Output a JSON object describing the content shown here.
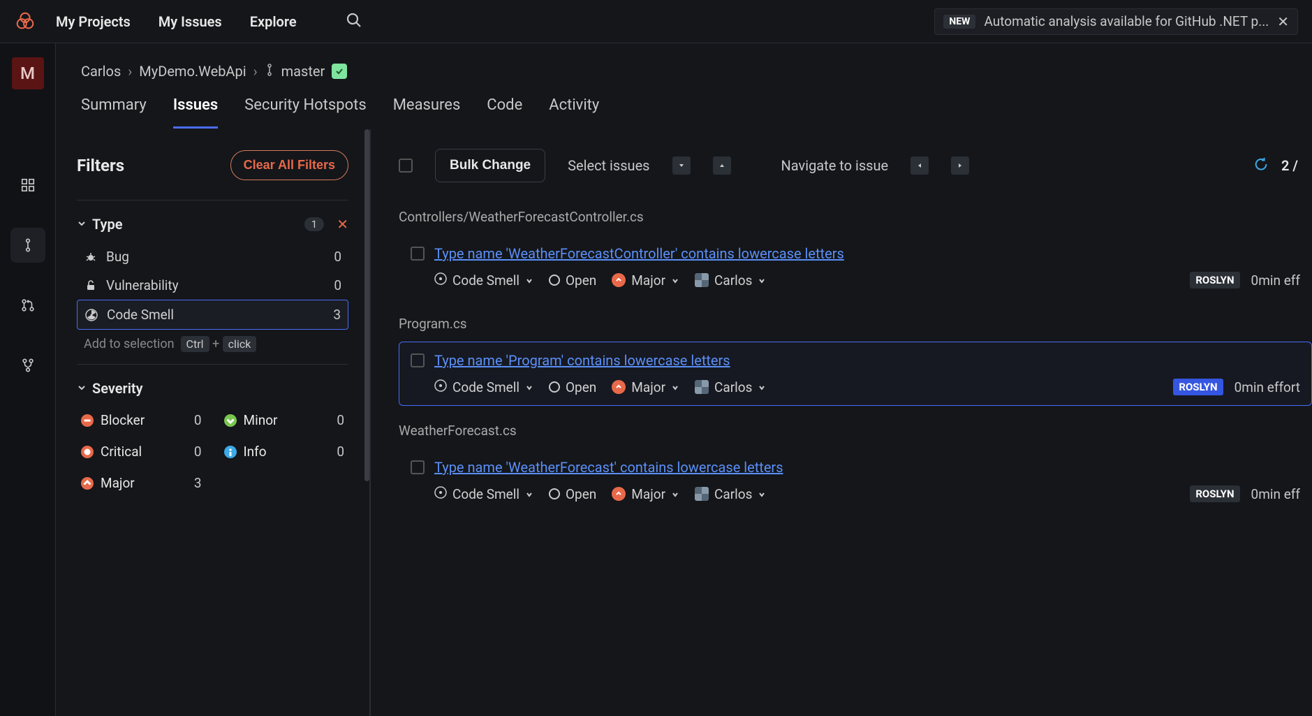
{
  "topnav": {
    "projects": "My Projects",
    "issues": "My Issues",
    "explore": "Explore"
  },
  "news": {
    "badge": "NEW",
    "text": "Automatic analysis available for GitHub .NET p..."
  },
  "avatar_letter": "M",
  "breadcrumb": {
    "owner": "Carlos",
    "project": "MyDemo.WebApi",
    "branch": "master"
  },
  "tabs": {
    "summary": "Summary",
    "issues": "Issues",
    "hotspots": "Security Hotspots",
    "measures": "Measures",
    "code": "Code",
    "activity": "Activity"
  },
  "filters": {
    "title": "Filters",
    "clear": "Clear All Filters",
    "type": {
      "label": "Type",
      "active_count": "1",
      "bug": {
        "label": "Bug",
        "count": "0"
      },
      "vuln": {
        "label": "Vulnerability",
        "count": "0"
      },
      "smell": {
        "label": "Code Smell",
        "count": "3"
      }
    },
    "hint": {
      "text": "Add to selection",
      "key1": "Ctrl",
      "plus": "+",
      "key2": "click"
    },
    "severity": {
      "label": "Severity",
      "blocker": {
        "label": "Blocker",
        "count": "0"
      },
      "critical": {
        "label": "Critical",
        "count": "0"
      },
      "major": {
        "label": "Major",
        "count": "3"
      },
      "minor": {
        "label": "Minor",
        "count": "0"
      },
      "info": {
        "label": "Info",
        "count": "0"
      }
    }
  },
  "toolbar": {
    "bulk": "Bulk Change",
    "select": "Select issues",
    "navigate": "Navigate to issue",
    "pager": "2 /"
  },
  "issues": {
    "file1": "Controllers/WeatherForecastController.cs",
    "issue1": {
      "title": "Type name 'WeatherForecastController' contains lowercase letters",
      "type": "Code Smell",
      "status": "Open",
      "severity": "Major",
      "assignee": "Carlos",
      "engine": "ROSLYN",
      "effort": "0min eff"
    },
    "file2": "Program.cs",
    "issue2": {
      "title": "Type name 'Program' contains lowercase letters",
      "type": "Code Smell",
      "status": "Open",
      "severity": "Major",
      "assignee": "Carlos",
      "engine": "ROSLYN",
      "effort": "0min effort"
    },
    "file3": "WeatherForecast.cs",
    "issue3": {
      "title": "Type name 'WeatherForecast' contains lowercase letters",
      "type": "Code Smell",
      "status": "Open",
      "severity": "Major",
      "assignee": "Carlos",
      "engine": "ROSLYN",
      "effort": "0min eff"
    }
  }
}
